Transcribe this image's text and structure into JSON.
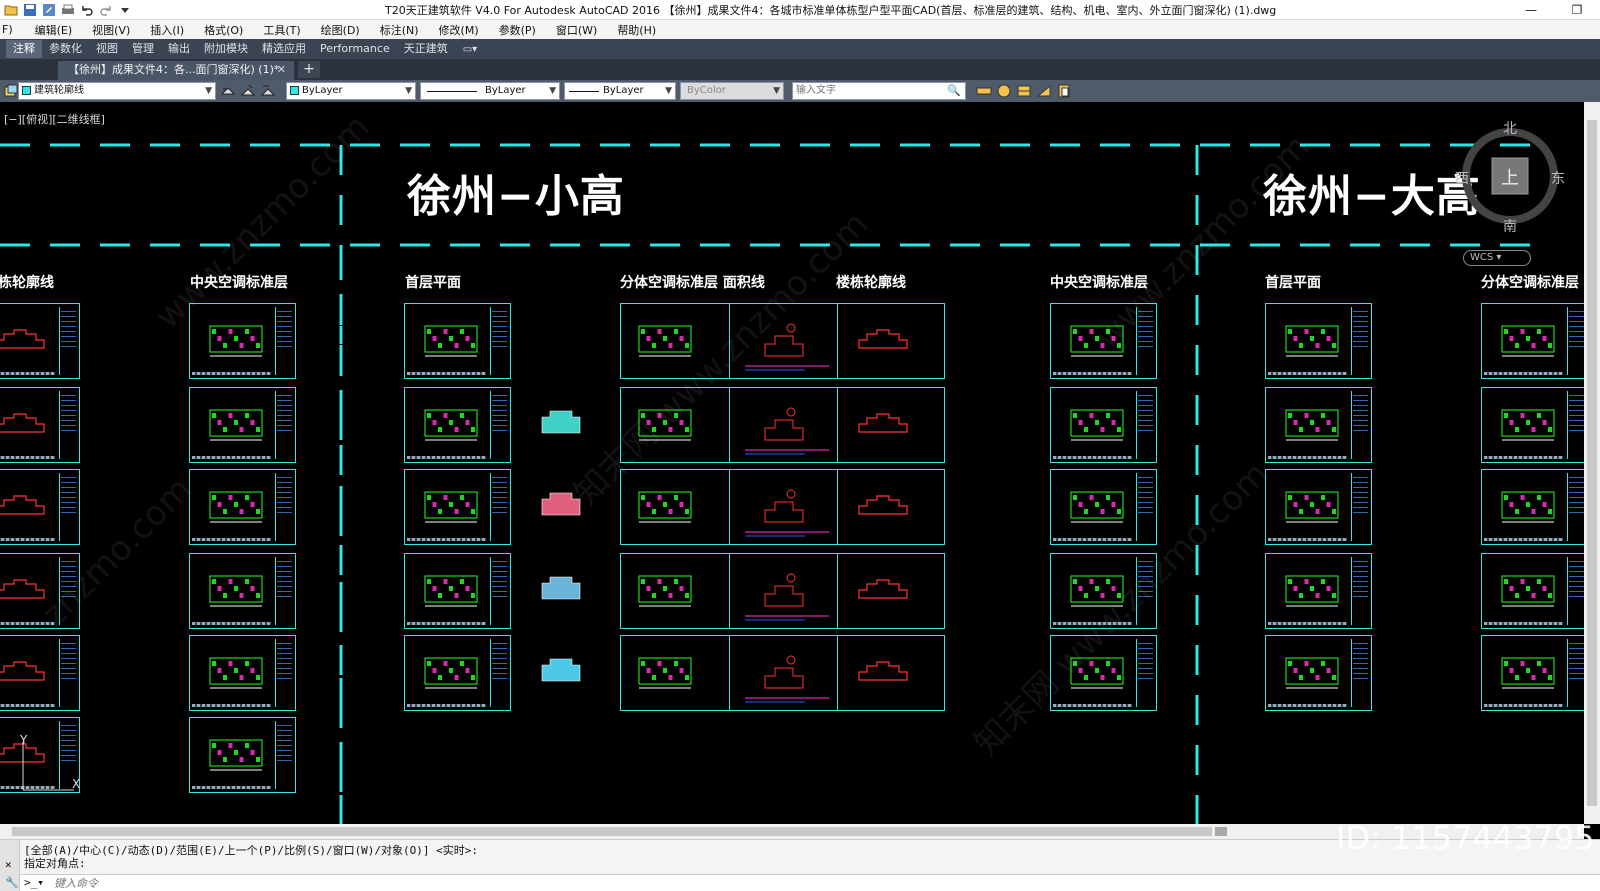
{
  "window": {
    "title": "T20天正建筑软件 V4.0 For Autodesk AutoCAD 2016    【徐州】成果文件4：各城市标准单体栋型户型平面CAD(首层、标准层的建筑、结构、机电、室内、外立面门窗深化) (1).dwg",
    "minimize": "—",
    "restore": "❐"
  },
  "menu": [
    "F)",
    "编辑(E)",
    "视图(V)",
    "插入(I)",
    "格式(O)",
    "工具(T)",
    "绘图(D)",
    "标注(N)",
    "修改(M)",
    "参数(P)",
    "窗口(W)",
    "帮助(H)"
  ],
  "ribbon_tabs": [
    "注释",
    "参数化",
    "视图",
    "管理",
    "输出",
    "附加模块",
    "精选应用",
    "Performance",
    "天正建筑"
  ],
  "ribbon_active": "注释",
  "doc_tab": {
    "label": "【徐州】成果文件4：各...面门窗深化) (1)*",
    "close": "✕",
    "new": "+"
  },
  "props": {
    "layer": "建筑轮廓线",
    "color": "ByLayer",
    "linetype": "ByLayer",
    "lineweight": "ByLayer",
    "plotstyle": "ByColor",
    "search_placeholder": "输入文字"
  },
  "canvas": {
    "view_label": "[−][俯视][二维线框]",
    "title_left": "徐州−小高",
    "title_right": "徐州−大高",
    "sections": [
      "栋轮廓线",
      "中央空调标准层",
      "首层平面",
      "分体空调标准层 面积线",
      "楼栋轮廓线",
      "中央空调标准层",
      "首层平面",
      "分体空调标准层"
    ],
    "compass": {
      "north": "北",
      "east": "东",
      "south": "南",
      "west": "西",
      "center": "上"
    },
    "wcs": "WCS"
  },
  "command": {
    "line1": "[全部(A)/中心(C)/动态(D)/范围(E)/上一个(P)/比例(S)/窗口(W)/对象(O)] <实时>:",
    "line2": "指定对角点:",
    "placeholder": "键入命令"
  },
  "watermark": {
    "logo": "知末",
    "id": "ID: 1157443795"
  },
  "colors": {
    "cyan": "#31e6e6",
    "plan_green": "#22ff22",
    "plan_magenta": "#ff33cc",
    "outline_red": "#ff3333",
    "ribbon_bg": "#3b4452"
  }
}
